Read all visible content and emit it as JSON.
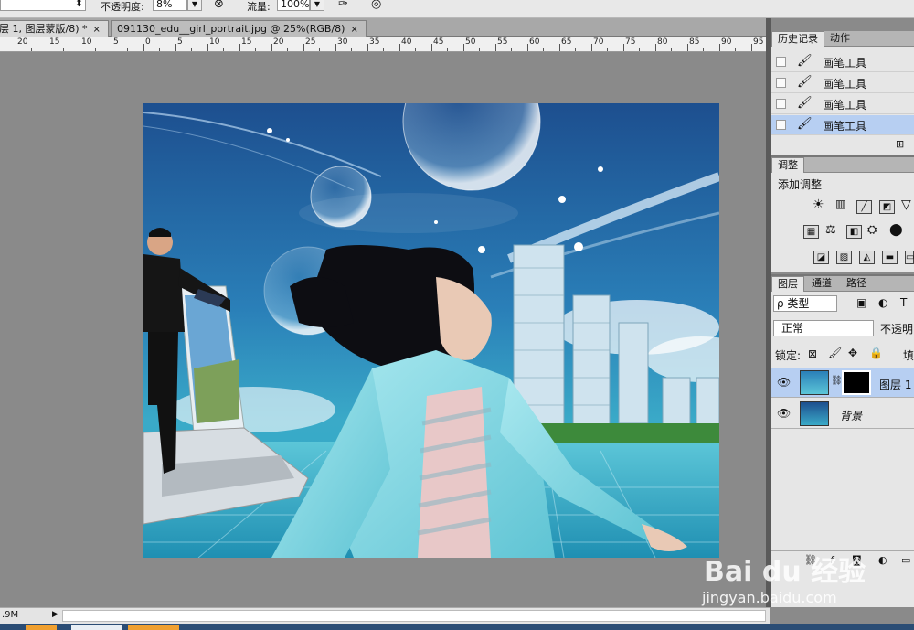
{
  "options_bar": {
    "opacity_label": "不透明度:",
    "opacity_value": "8%",
    "flow_label": "流量:",
    "flow_value": "100%"
  },
  "doc_tabs": [
    {
      "label": "层 1, 图层蒙版/8) *",
      "close": "×"
    },
    {
      "label": "091130_edu__girl_portrait.jpg @ 25%(RGB/8)",
      "close": "×"
    }
  ],
  "ruler_labels": [
    "20",
    "15",
    "10",
    "5",
    "0",
    "5",
    "10",
    "15",
    "20",
    "25",
    "30",
    "35",
    "40",
    "45",
    "50",
    "55",
    "60",
    "65",
    "70",
    "75",
    "80",
    "85",
    "90",
    "95"
  ],
  "status": {
    "size": ".9M",
    "arrow": "▶"
  },
  "history_panel": {
    "tabs": [
      "历史记录",
      "动作"
    ],
    "items": [
      "画笔工具",
      "画笔工具",
      "画笔工具",
      "画笔工具"
    ]
  },
  "adjust_panel": {
    "tab": "调整",
    "title": "添加调整"
  },
  "layers_panel": {
    "tabs": [
      "图层",
      "通道",
      "路径"
    ],
    "filter_label": "ρ 类型",
    "blend_mode": "正常",
    "opacity_label": "不透明",
    "lock_label": "锁定:",
    "fill_label": "填",
    "layers": [
      {
        "name": "图层 1",
        "selected": true
      },
      {
        "name": "背景",
        "selected": false,
        "italic": true
      }
    ]
  },
  "watermark": {
    "brand": "Bai du 经验",
    "url": "jingyan.baidu.com"
  }
}
